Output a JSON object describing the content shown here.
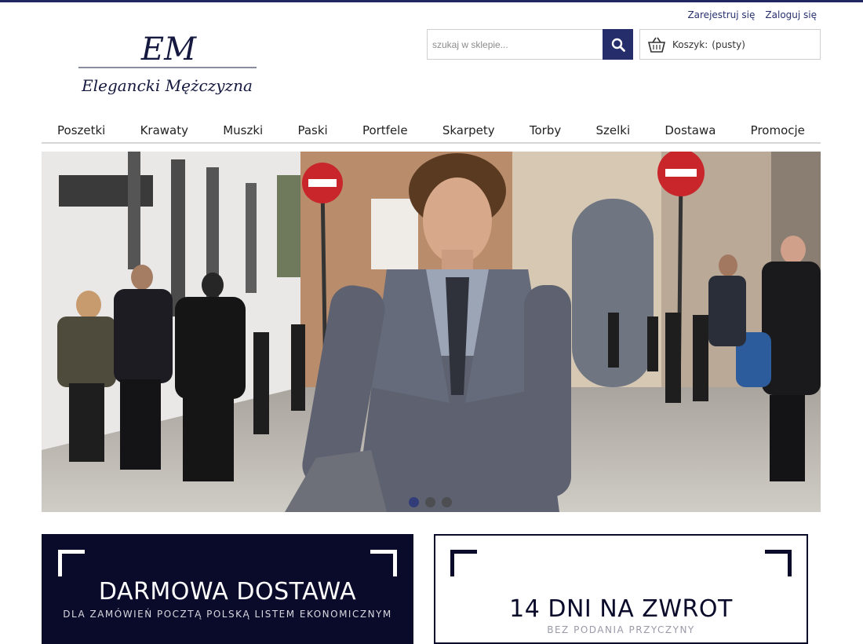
{
  "header": {
    "register_label": "Zarejestruj się",
    "login_label": "Zaloguj się",
    "logo_monogram": "EM",
    "logo_name": "Elegancki Mężczyzna"
  },
  "search": {
    "placeholder": "szukaj w sklepie..."
  },
  "cart": {
    "label": "Koszyk:",
    "status": "(pusty)"
  },
  "nav": {
    "items": [
      "Poszetki",
      "Krawaty",
      "Muszki",
      "Paski",
      "Portfele",
      "Skarpety",
      "Torby",
      "Szelki",
      "Dostawa",
      "Promocje"
    ]
  },
  "slider": {
    "slide_count": 3,
    "active_index": 0
  },
  "promos": [
    {
      "title": "DARMOWA DOSTAWA",
      "subtitle": "DLA ZAMÓWIEŃ POCZTĄ POLSKĄ LISTEM EKONOMICZNYM"
    },
    {
      "title": "14 DNI NA ZWROT",
      "subtitle": "BEZ PODANIA PRZYCZYNY"
    }
  ],
  "colors": {
    "brand_navy": "#252d6b",
    "promo_dark": "#0a0a2a"
  }
}
